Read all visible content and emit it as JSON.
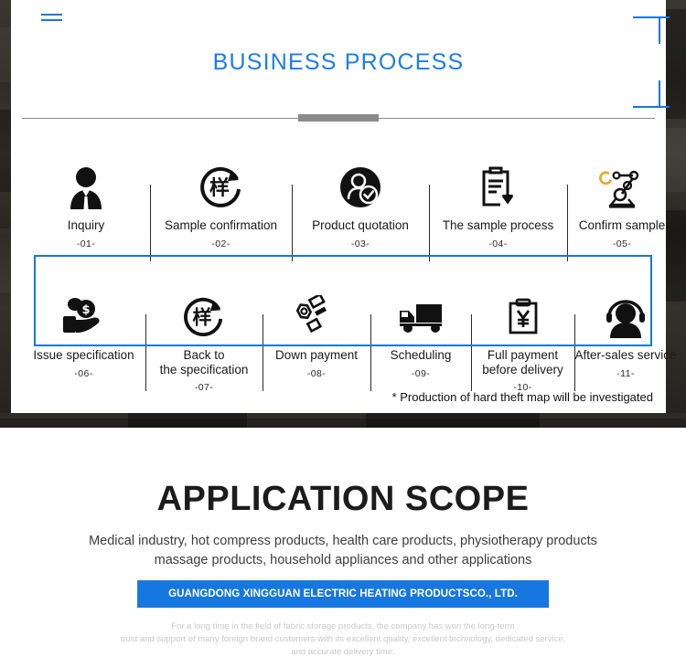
{
  "theme": {
    "accent_blue": "#1777e0",
    "title_blue": "#1b7cf2",
    "icon_black": "#111111",
    "icon_orange": "#f0a526"
  },
  "top": {
    "menu_icon": "hamburger-icon",
    "title": "BUSINESS PROCESS",
    "footnote": "* Production of hard theft map will be investigated",
    "process_rows": [
      {
        "row": 1,
        "items": [
          {
            "label": "Inquiry",
            "number": "-01-",
            "icon": "businessman-icon"
          },
          {
            "label": "Sample confirmation",
            "number": "-02-",
            "icon": "sample-refresh-icon"
          },
          {
            "label": "Product quotation",
            "number": "-03-",
            "icon": "user-check-icon"
          },
          {
            "label": "The sample process",
            "number": "-04-",
            "icon": "clipboard-download-icon"
          },
          {
            "label": "Confirm sample",
            "number": "-05-",
            "icon": "robot-arm-icon"
          }
        ]
      },
      {
        "row": 2,
        "items": [
          {
            "label": "Issue specification",
            "number": "-06-",
            "icon": "hand-money-icon"
          },
          {
            "label": "Back to\nthe specification",
            "number": "-07-",
            "icon": "sample-refresh-icon"
          },
          {
            "label": "Down payment",
            "number": "-08-",
            "icon": "coins-tilt-icon"
          },
          {
            "label": "Scheduling",
            "number": "-09-",
            "icon": "delivery-truck-icon"
          },
          {
            "label": "Full payment\nbefore delivery",
            "number": "-10-",
            "icon": "clipboard-yen-icon"
          },
          {
            "label": "After-sales service",
            "number": "-11-",
            "icon": "headset-support-icon"
          }
        ]
      }
    ]
  },
  "bottom": {
    "title": "APPLICATION SCOPE",
    "description_line1": "Medical industry, hot compress products, health care products, physiotherapy products",
    "description_line2": "massage products, household appliances and other applications",
    "company_bar": "GUANGDONG XINGGUAN ELECTRIC HEATING PRODUCTSCO., LTD.",
    "footer_line1": "For a long time in the field of fabric storage products, the company has won the long-term",
    "footer_line2": "trust and support of many foreign brand customers with its excellent quality, excellent technology, dedicated service,",
    "footer_line3": "and accurate delivery time."
  }
}
